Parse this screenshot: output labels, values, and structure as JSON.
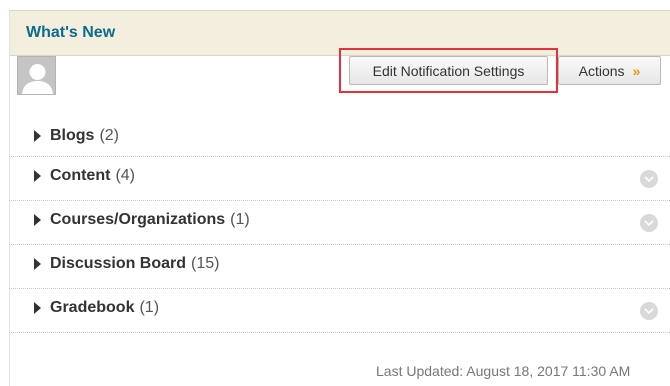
{
  "module": {
    "title": "What's New"
  },
  "toolbar": {
    "edit_notifications_label": "Edit Notification Settings",
    "actions_label": "Actions"
  },
  "items": [
    {
      "name": "Blogs",
      "count": "(2)",
      "has_menu": false
    },
    {
      "name": "Content",
      "count": "(4)",
      "has_menu": true
    },
    {
      "name": "Courses/Organizations",
      "count": "(1)",
      "has_menu": true
    },
    {
      "name": "Discussion Board",
      "count": "(15)",
      "has_menu": false
    },
    {
      "name": "Gradebook",
      "count": "(1)",
      "has_menu": true
    }
  ],
  "footer": {
    "last_updated": "Last Updated: August 18, 2017 11:30 AM"
  },
  "icons": {
    "avatar": "user-avatar-icon",
    "expand": "triangle-right-icon",
    "actions_chevron": "double-chevron-down-icon",
    "row_menu": "chevron-down-circle-icon"
  },
  "colors": {
    "header_bg": "#f3eedd",
    "title": "#0c6b8f",
    "highlight": "#e0333c",
    "chevron": "#e69a00"
  }
}
